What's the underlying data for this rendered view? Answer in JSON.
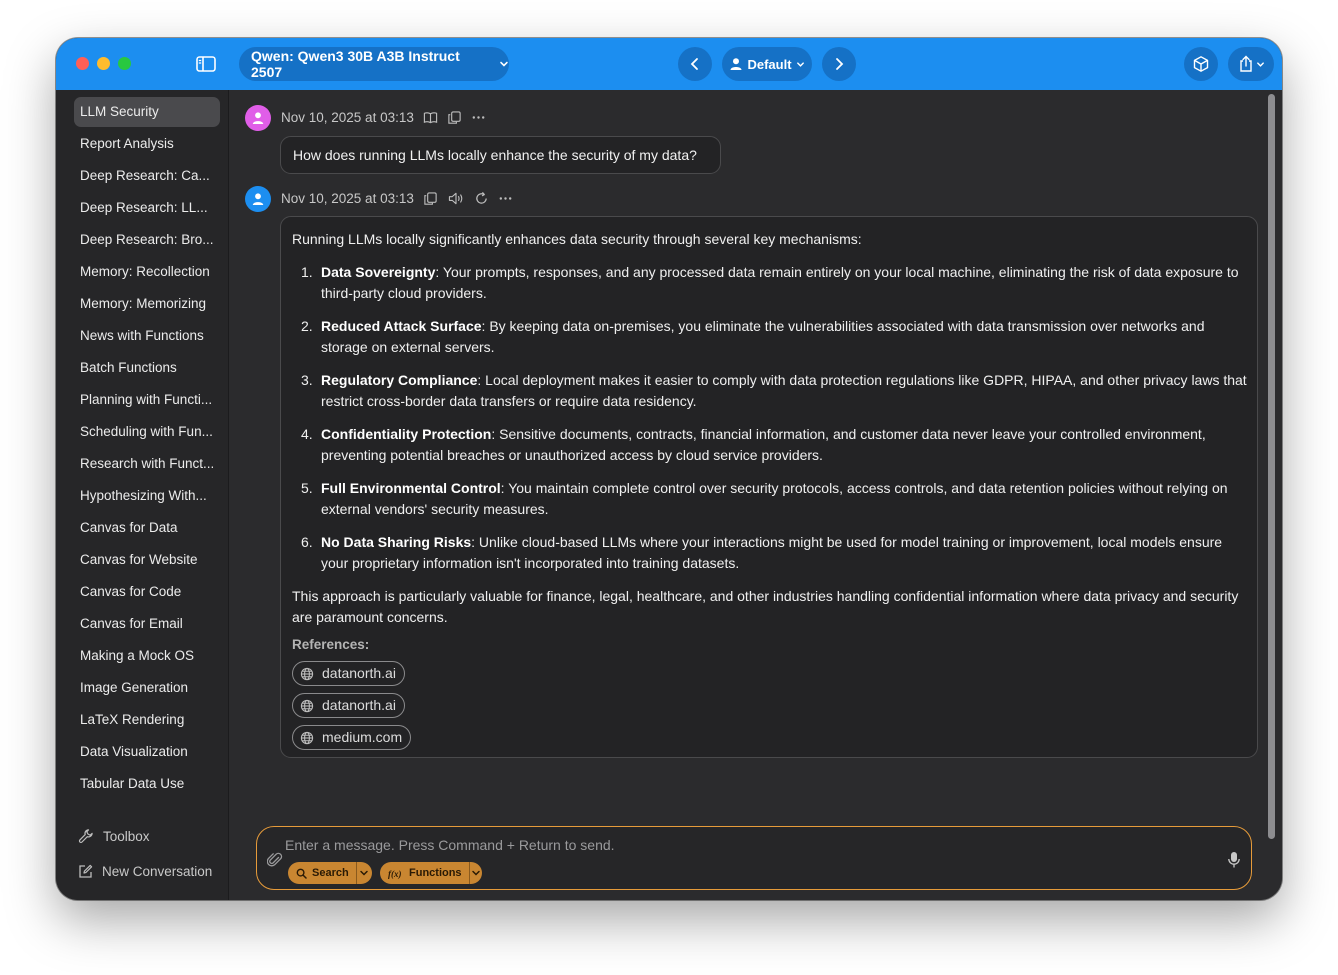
{
  "titlebar": {
    "model_label": "Qwen: Qwen3 30B A3B Instruct 2507",
    "profile_label": "Default"
  },
  "sidebar": {
    "items": [
      {
        "label": "LLM Security",
        "active": true
      },
      {
        "label": "Report Analysis"
      },
      {
        "label": "Deep Research: Ca..."
      },
      {
        "label": "Deep Research: LL..."
      },
      {
        "label": "Deep Research: Bro..."
      },
      {
        "label": "Memory: Recollection"
      },
      {
        "label": "Memory: Memorizing"
      },
      {
        "label": "News with Functions"
      },
      {
        "label": "Batch Functions"
      },
      {
        "label": "Planning with Functi..."
      },
      {
        "label": "Scheduling with Fun..."
      },
      {
        "label": "Research with Funct..."
      },
      {
        "label": "Hypothesizing With..."
      },
      {
        "label": "Canvas for Data"
      },
      {
        "label": "Canvas for Website"
      },
      {
        "label": "Canvas for Code"
      },
      {
        "label": "Canvas for Email"
      },
      {
        "label": "Making a Mock OS"
      },
      {
        "label": "Image Generation"
      },
      {
        "label": "LaTeX Rendering"
      },
      {
        "label": "Data Visualization"
      },
      {
        "label": "Tabular Data Use"
      }
    ],
    "toolbox_label": "Toolbox",
    "new_conversation_label": "New Conversation"
  },
  "colors": {
    "titlebar": "#1c8ef0",
    "user_avatar": "#e05ee8",
    "assistant_avatar": "#1c8ef0",
    "composer_border": "#e69b3a",
    "tool_pill": "#c98631"
  },
  "conversation": {
    "user_message": {
      "timestamp": "Nov 10, 2025 at 03:13",
      "text": "How does running LLMs locally enhance the security of my data?"
    },
    "assistant_message": {
      "timestamp": "Nov 10, 2025 at 03:13",
      "intro": "Running LLMs locally significantly enhances data security through several key mechanisms:",
      "points": [
        {
          "num": "1.",
          "title": "Data Sovereignty",
          "text": ": Your prompts, responses, and any processed data remain entirely on your local machine, eliminating the risk of data exposure to third-party cloud providers."
        },
        {
          "num": "2.",
          "title": "Reduced Attack Surface",
          "text": ": By keeping data on-premises, you eliminate the vulnerabilities associated with data transmission over networks and storage on external servers."
        },
        {
          "num": "3.",
          "title": "Regulatory Compliance",
          "text": ": Local deployment makes it easier to comply with data protection regulations like GDPR, HIPAA, and other privacy laws that restrict cross-border data transfers or require data residency."
        },
        {
          "num": "4.",
          "title": "Confidentiality Protection",
          "text": ": Sensitive documents, contracts, financial information, and customer data never leave your controlled environment, preventing potential breaches or unauthorized access by cloud service providers."
        },
        {
          "num": "5.",
          "title": "Full Environmental Control",
          "text": ": You maintain complete control over security protocols, access controls, and data retention policies without relying on external vendors' security measures."
        },
        {
          "num": "6.",
          "title": "No Data Sharing Risks",
          "text": ": Unlike cloud-based LLMs where your interactions might be used for model training or improvement, local models ensure your proprietary information isn't incorporated into training datasets."
        }
      ],
      "conclusion": "This approach is particularly valuable for finance, legal, healthcare, and other industries handling confidential information where data privacy and security are paramount concerns.",
      "references_label": "References:",
      "references": [
        "datanorth.ai",
        "datanorth.ai",
        "medium.com"
      ]
    }
  },
  "composer": {
    "placeholder": "Enter a message. Press Command + Return to send.",
    "search_label": "Search",
    "functions_label": "Functions"
  }
}
